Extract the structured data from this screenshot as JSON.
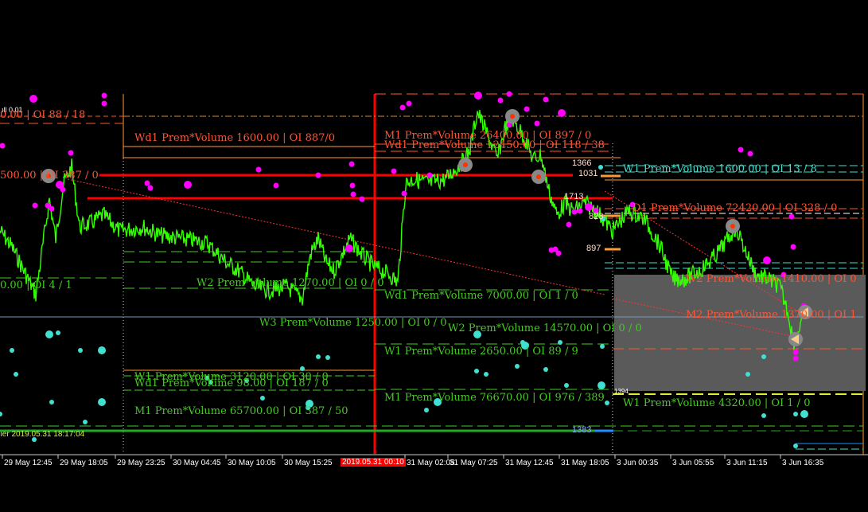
{
  "colors": {
    "background": "#000000",
    "price": "#33ff00",
    "green_label": "#44cc22",
    "red_label": "#ff5533",
    "magenta": "#ff00ff",
    "cyan": "#40e0d0",
    "orange": "#ff9933",
    "red_line": "#ff0000",
    "box": "#5a5a5a"
  },
  "corner": {
    "top_left": "ıll 0.01"
  },
  "levels_left": {
    "l1": "0.00 | OI 88 / 18",
    "l2": "500.00 | OI 387 / 0",
    "l3": "0.00 | OI 4 / 1",
    "l4": "ıer 2019.05.31 18:17:04"
  },
  "labels": {
    "wd1_top": "Wd1 Prem*Volume 1600.00 | OI 887/0",
    "m1_a": "M1 Prem*Volume 26400.00 | OI 897 / 0",
    "wd1_a": "Wd1 Prem*Volume 12450.00 | OI 118 / 38",
    "w1_right": "W1 Prem*Volume 1600.00 | OI 13 / 8",
    "d1_right": "D1 Prem*Volume 72420.00 | OI 328 / 0",
    "w2_a": "W2 Prem*Volume 1270.00 | OI 0 / 0",
    "w2_right": "W2 Prem*Volume 1410.00 | OI 0",
    "wd1_b": "Wd1 Prem*Volume 7000.00 | OI 1 / 0",
    "w3": "W3 Prem*Volume 1250.00 | OI 0 / 0",
    "w2_b": "W2 Prem*Volume 14570.00 | OI 0 / 0",
    "m2_right": "M2 Prem*Volume 1370.00 | OI 1",
    "w1_a": "W1 Prem*Volume 2650.00 | OI 89 / 9",
    "w1_b": "W1 Prem*Volume 3120.00 | OI 30 / 0",
    "wd1_c": "Wd1 Prem*Volume 98.00 | OI 187 / 0",
    "m1_b": "M1 Prem*Volume 65700.00 | OI 387 / 50",
    "m1_c": "M1 Prem*Volume 76670.00 | OI 976 / 389",
    "w1_c": "W1 Prem*Volume 4320.00 | OI 1 / 0"
  },
  "price_levels": {
    "p1366": "1366",
    "p1031": "1031",
    "p1713": "1713",
    "p828": "828",
    "p897": "897",
    "p1383": "1383",
    "p_small": "1394"
  },
  "time_axis": {
    "ticks": [
      "29 May 12:45",
      "29 May 18:05",
      "29 May 23:25",
      "30 May 04:45",
      "30 May 10:05",
      "30 May 15:25",
      "31 May 02:05",
      "31 May 07:25",
      "31 May 12:45",
      "31 May 18:05",
      "3 Jun 00:35",
      "3 Jun 05:55",
      "3 Jun 11:15",
      "3 Jun 16:35"
    ],
    "highlight": "2019.05.31 00:10"
  }
}
